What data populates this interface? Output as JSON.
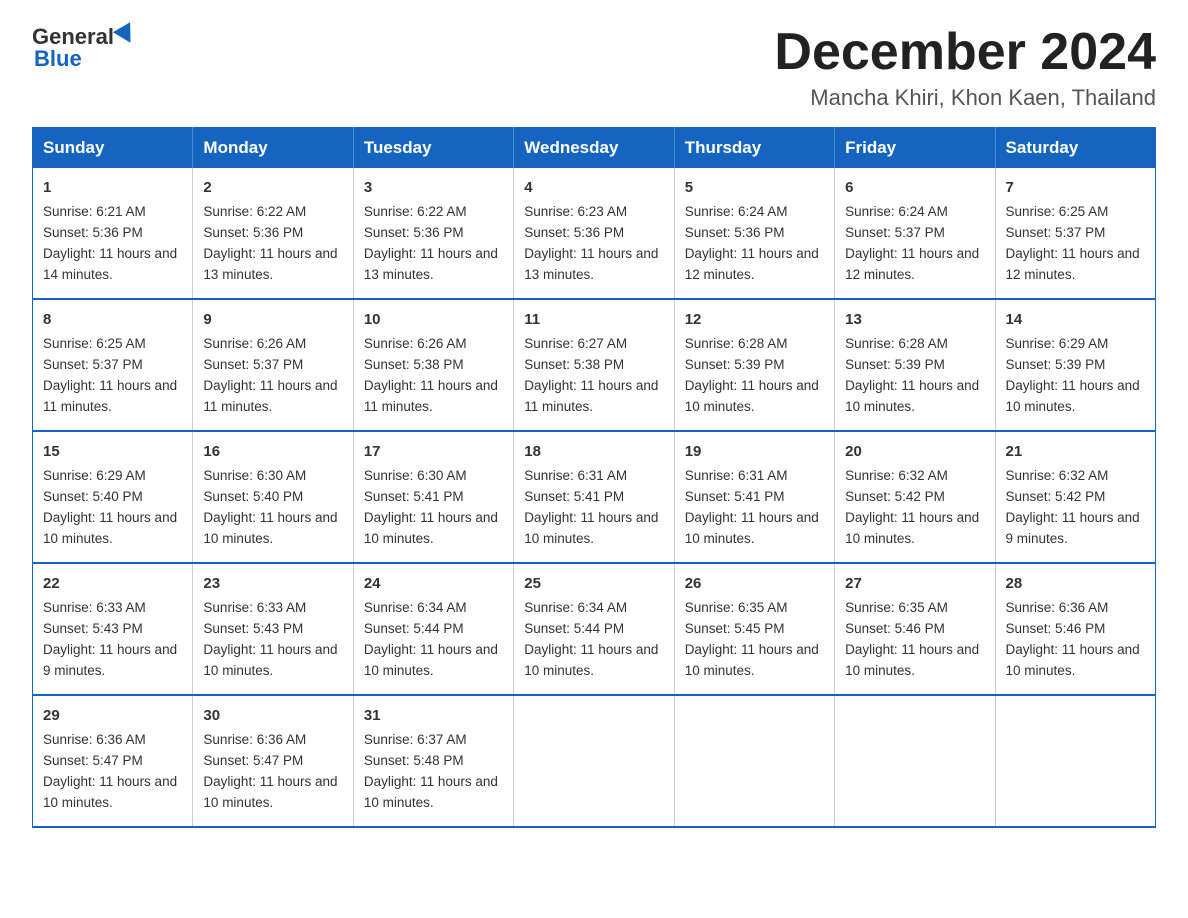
{
  "logo": {
    "general": "General",
    "arrow": "▲",
    "blue": "Blue"
  },
  "title": "December 2024",
  "subtitle": "Mancha Khiri, Khon Kaen, Thailand",
  "days_of_week": [
    "Sunday",
    "Monday",
    "Tuesday",
    "Wednesday",
    "Thursday",
    "Friday",
    "Saturday"
  ],
  "weeks": [
    [
      {
        "day": "1",
        "sunrise": "Sunrise: 6:21 AM",
        "sunset": "Sunset: 5:36 PM",
        "daylight": "Daylight: 11 hours and 14 minutes."
      },
      {
        "day": "2",
        "sunrise": "Sunrise: 6:22 AM",
        "sunset": "Sunset: 5:36 PM",
        "daylight": "Daylight: 11 hours and 13 minutes."
      },
      {
        "day": "3",
        "sunrise": "Sunrise: 6:22 AM",
        "sunset": "Sunset: 5:36 PM",
        "daylight": "Daylight: 11 hours and 13 minutes."
      },
      {
        "day": "4",
        "sunrise": "Sunrise: 6:23 AM",
        "sunset": "Sunset: 5:36 PM",
        "daylight": "Daylight: 11 hours and 13 minutes."
      },
      {
        "day": "5",
        "sunrise": "Sunrise: 6:24 AM",
        "sunset": "Sunset: 5:36 PM",
        "daylight": "Daylight: 11 hours and 12 minutes."
      },
      {
        "day": "6",
        "sunrise": "Sunrise: 6:24 AM",
        "sunset": "Sunset: 5:37 PM",
        "daylight": "Daylight: 11 hours and 12 minutes."
      },
      {
        "day": "7",
        "sunrise": "Sunrise: 6:25 AM",
        "sunset": "Sunset: 5:37 PM",
        "daylight": "Daylight: 11 hours and 12 minutes."
      }
    ],
    [
      {
        "day": "8",
        "sunrise": "Sunrise: 6:25 AM",
        "sunset": "Sunset: 5:37 PM",
        "daylight": "Daylight: 11 hours and 11 minutes."
      },
      {
        "day": "9",
        "sunrise": "Sunrise: 6:26 AM",
        "sunset": "Sunset: 5:37 PM",
        "daylight": "Daylight: 11 hours and 11 minutes."
      },
      {
        "day": "10",
        "sunrise": "Sunrise: 6:26 AM",
        "sunset": "Sunset: 5:38 PM",
        "daylight": "Daylight: 11 hours and 11 minutes."
      },
      {
        "day": "11",
        "sunrise": "Sunrise: 6:27 AM",
        "sunset": "Sunset: 5:38 PM",
        "daylight": "Daylight: 11 hours and 11 minutes."
      },
      {
        "day": "12",
        "sunrise": "Sunrise: 6:28 AM",
        "sunset": "Sunset: 5:39 PM",
        "daylight": "Daylight: 11 hours and 10 minutes."
      },
      {
        "day": "13",
        "sunrise": "Sunrise: 6:28 AM",
        "sunset": "Sunset: 5:39 PM",
        "daylight": "Daylight: 11 hours and 10 minutes."
      },
      {
        "day": "14",
        "sunrise": "Sunrise: 6:29 AM",
        "sunset": "Sunset: 5:39 PM",
        "daylight": "Daylight: 11 hours and 10 minutes."
      }
    ],
    [
      {
        "day": "15",
        "sunrise": "Sunrise: 6:29 AM",
        "sunset": "Sunset: 5:40 PM",
        "daylight": "Daylight: 11 hours and 10 minutes."
      },
      {
        "day": "16",
        "sunrise": "Sunrise: 6:30 AM",
        "sunset": "Sunset: 5:40 PM",
        "daylight": "Daylight: 11 hours and 10 minutes."
      },
      {
        "day": "17",
        "sunrise": "Sunrise: 6:30 AM",
        "sunset": "Sunset: 5:41 PM",
        "daylight": "Daylight: 11 hours and 10 minutes."
      },
      {
        "day": "18",
        "sunrise": "Sunrise: 6:31 AM",
        "sunset": "Sunset: 5:41 PM",
        "daylight": "Daylight: 11 hours and 10 minutes."
      },
      {
        "day": "19",
        "sunrise": "Sunrise: 6:31 AM",
        "sunset": "Sunset: 5:41 PM",
        "daylight": "Daylight: 11 hours and 10 minutes."
      },
      {
        "day": "20",
        "sunrise": "Sunrise: 6:32 AM",
        "sunset": "Sunset: 5:42 PM",
        "daylight": "Daylight: 11 hours and 10 minutes."
      },
      {
        "day": "21",
        "sunrise": "Sunrise: 6:32 AM",
        "sunset": "Sunset: 5:42 PM",
        "daylight": "Daylight: 11 hours and 9 minutes."
      }
    ],
    [
      {
        "day": "22",
        "sunrise": "Sunrise: 6:33 AM",
        "sunset": "Sunset: 5:43 PM",
        "daylight": "Daylight: 11 hours and 9 minutes."
      },
      {
        "day": "23",
        "sunrise": "Sunrise: 6:33 AM",
        "sunset": "Sunset: 5:43 PM",
        "daylight": "Daylight: 11 hours and 10 minutes."
      },
      {
        "day": "24",
        "sunrise": "Sunrise: 6:34 AM",
        "sunset": "Sunset: 5:44 PM",
        "daylight": "Daylight: 11 hours and 10 minutes."
      },
      {
        "day": "25",
        "sunrise": "Sunrise: 6:34 AM",
        "sunset": "Sunset: 5:44 PM",
        "daylight": "Daylight: 11 hours and 10 minutes."
      },
      {
        "day": "26",
        "sunrise": "Sunrise: 6:35 AM",
        "sunset": "Sunset: 5:45 PM",
        "daylight": "Daylight: 11 hours and 10 minutes."
      },
      {
        "day": "27",
        "sunrise": "Sunrise: 6:35 AM",
        "sunset": "Sunset: 5:46 PM",
        "daylight": "Daylight: 11 hours and 10 minutes."
      },
      {
        "day": "28",
        "sunrise": "Sunrise: 6:36 AM",
        "sunset": "Sunset: 5:46 PM",
        "daylight": "Daylight: 11 hours and 10 minutes."
      }
    ],
    [
      {
        "day": "29",
        "sunrise": "Sunrise: 6:36 AM",
        "sunset": "Sunset: 5:47 PM",
        "daylight": "Daylight: 11 hours and 10 minutes."
      },
      {
        "day": "30",
        "sunrise": "Sunrise: 6:36 AM",
        "sunset": "Sunset: 5:47 PM",
        "daylight": "Daylight: 11 hours and 10 minutes."
      },
      {
        "day": "31",
        "sunrise": "Sunrise: 6:37 AM",
        "sunset": "Sunset: 5:48 PM",
        "daylight": "Daylight: 11 hours and 10 minutes."
      },
      null,
      null,
      null,
      null
    ]
  ]
}
